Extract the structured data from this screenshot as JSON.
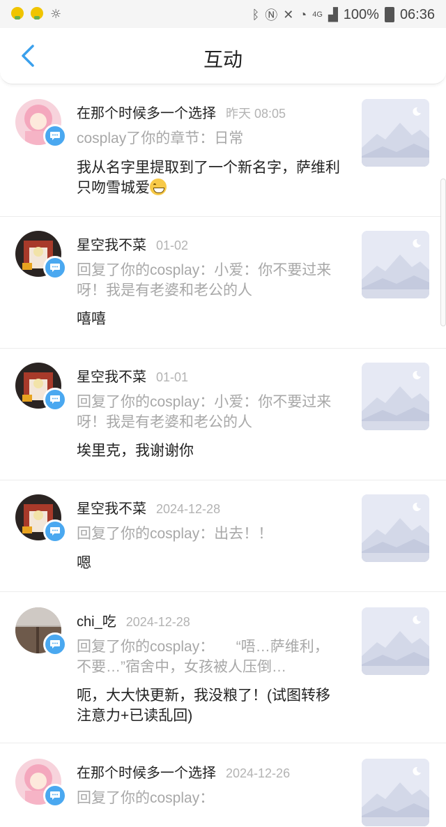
{
  "status_bar": {
    "battery": "100%",
    "time": "06:36",
    "network": "4G"
  },
  "header": {
    "title": "互动"
  },
  "items": [
    {
      "name": "在那个时候多一个选择",
      "time": "昨天 08:05",
      "action": "cosplay了你的章节：日常",
      "comment": "我从名字里提取到了一个新名字，萨维利只吻雪城爱",
      "avatar": "pink"
    },
    {
      "name": "星空我不菜",
      "time": "01-02",
      "action": "回复了你的cosplay：小爱：你不要过来呀！我是有老婆和老公的人",
      "comment": "嘻嘻",
      "avatar": "dark"
    },
    {
      "name": "星空我不菜",
      "time": "01-01",
      "action": "回复了你的cosplay：小爱：你不要过来呀！我是有老婆和老公的人",
      "comment": "埃里克，我谢谢你",
      "avatar": "dark"
    },
    {
      "name": "星空我不菜",
      "time": "2024-12-28",
      "action": "回复了你的cosplay：出去！！",
      "comment": "嗯",
      "avatar": "dark"
    },
    {
      "name": "chi_吃",
      "time": "2024-12-28",
      "action": "回复了你的cosplay：　　“唔…萨维利，不要…”宿舍中，女孩被人压倒…",
      "comment": "呃，大大快更新，我没粮了！(试图转移注意力+已读乱回)",
      "avatar": "brown"
    },
    {
      "name": "在那个时候多一个选择",
      "time": "2024-12-26",
      "action": "回复了你的cosplay：",
      "comment": "",
      "avatar": "pink"
    }
  ],
  "colors": {
    "accent": "#4aa8f0",
    "secondary_text": "#a8a8a8"
  }
}
